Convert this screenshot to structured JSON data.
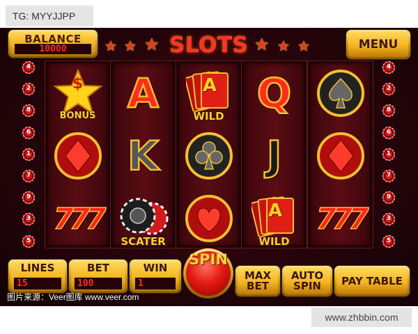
{
  "watermark_top": "TG: MYYJJPP",
  "watermark_bottom": "www.zhbbin.com",
  "credit": "图片来源：Veer图库 www.veer.com",
  "header": {
    "balance_label": "BALANCE",
    "balance_value": "10000",
    "title": "SLOTS",
    "menu_label": "MENU"
  },
  "paylines": {
    "left": [
      "4",
      "2",
      "8",
      "6",
      "1",
      "7",
      "9",
      "3",
      "5"
    ],
    "right": [
      "4",
      "2",
      "8",
      "6",
      "1",
      "7",
      "9",
      "3",
      "5"
    ]
  },
  "reels": [
    [
      {
        "symbol": "star",
        "label": "BONUS",
        "glyph": "$"
      },
      {
        "symbol": "diamond-icon"
      },
      {
        "symbol": "sevens",
        "glyph": "777"
      }
    ],
    [
      {
        "symbol": "letter",
        "glyph": "A"
      },
      {
        "symbol": "letter",
        "glyph": "K"
      },
      {
        "symbol": "chips",
        "label": "SCATER"
      }
    ],
    [
      {
        "symbol": "cards",
        "glyph": "A",
        "label": "WILD"
      },
      {
        "symbol": "club-icon"
      },
      {
        "symbol": "heart-icon"
      }
    ],
    [
      {
        "symbol": "letter",
        "glyph": "Q"
      },
      {
        "symbol": "letter",
        "glyph": "J"
      },
      {
        "symbol": "cards",
        "glyph": "A",
        "label": "WILD"
      }
    ],
    [
      {
        "symbol": "spade-icon"
      },
      {
        "symbol": "diamond-icon"
      },
      {
        "symbol": "sevens",
        "glyph": "777"
      }
    ]
  ],
  "footer": {
    "lines_label": "LINES",
    "lines_value": "15",
    "bet_label": "BET",
    "bet_value": "100",
    "win_label": "WIN",
    "win_value": "1",
    "spin_label": "SPIN",
    "maxbet_label": [
      "MAX",
      "BET"
    ],
    "autospin_label": [
      "AUTO",
      "SPIN"
    ],
    "paytable_label": "PAY TABLE"
  },
  "colors": {
    "gold": "#f2b520",
    "red": "#e21a10",
    "background": "#25040a",
    "display_red": "#ff2a2a"
  }
}
